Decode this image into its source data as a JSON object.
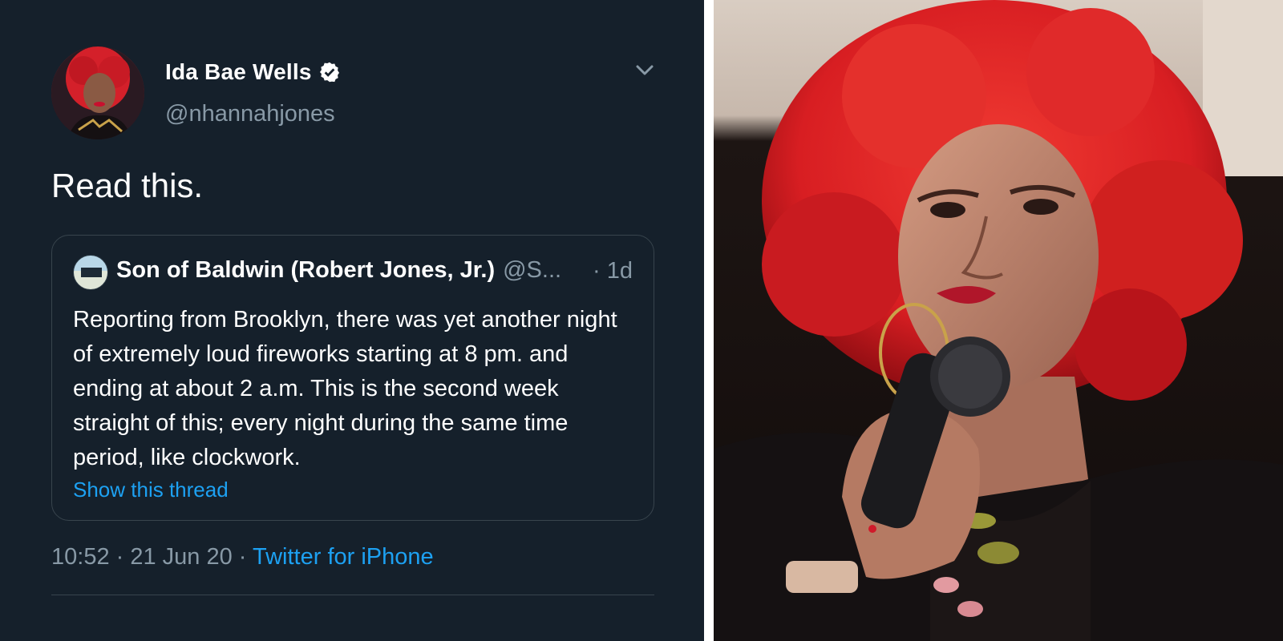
{
  "tweet": {
    "display_name": "Ida Bae Wells",
    "verified_icon": "verified-badge-icon",
    "handle": "@nhannahjones",
    "text": "Read this.",
    "timestamp": "10:52 · 21 Jun 20 · ",
    "source": "Twitter for iPhone"
  },
  "quote": {
    "display_name": "Son of Baldwin (Robert Jones, Jr.)",
    "handle": "@S...",
    "time": "· 1d",
    "body": "Reporting from Brooklyn, there was yet another night of extremely loud fireworks starting at 8 pm. and ending at about 2 a.m. This is the second week straight of this; every night during the same time period, like clockwork.",
    "show_thread": "Show this thread"
  },
  "colors": {
    "background": "#15202b",
    "accent": "#1da1f2",
    "muted_text": "#8899a6",
    "border": "#38444d"
  }
}
